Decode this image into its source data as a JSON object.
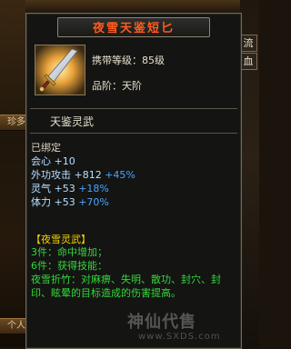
{
  "background": {
    "left_button_1": "珍多",
    "left_button_2": "个人",
    "right_slot_1": "流",
    "right_slot_2": "血"
  },
  "tooltip": {
    "title": "夜雪天鉴短匕",
    "icon": "dagger-icon",
    "level_req": "携带等级：85级",
    "grade": "品阶：天阶",
    "weapon_type": "天鉴灵武",
    "bound": "已绑定",
    "stats": [
      {
        "name": "会心",
        "value": "+10",
        "bonus": ""
      },
      {
        "name": "外功攻击",
        "value": "+812",
        "bonus": "+45%"
      },
      {
        "name": "灵气",
        "value": "+53",
        "bonus": "+18%"
      },
      {
        "name": "体力",
        "value": "+53",
        "bonus": "+70%"
      }
    ],
    "set_title": "【夜雪灵武】",
    "set_3": "3件：命中增加；",
    "set_6": "6件：获得技能：",
    "set_desc": "夜雪折竹：对麻痹、失明、散功、封穴、封印、眩晕的目标造成的伤害提高。"
  },
  "watermark": {
    "text": "神仙代售",
    "url": "www.SXDS.com"
  },
  "colors": {
    "title": "#ff5a1e",
    "stat": "#b6e0ff",
    "bonus": "#4aa4ff",
    "set_title": "#f0d000",
    "set_text": "#33d83a"
  }
}
